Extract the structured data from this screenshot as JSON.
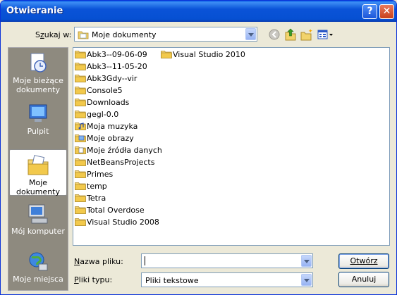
{
  "window": {
    "title": "Otwieranie",
    "help_label": "?",
    "close_label": "✕"
  },
  "toolbar": {
    "look_in_label": "Szukaj w:",
    "look_in_value": "Moje dokumenty",
    "icons": [
      "back-icon",
      "up-folder-icon",
      "new-folder-icon",
      "views-menu-icon"
    ]
  },
  "places": [
    {
      "label": "Moje bieżące dokumenty",
      "icon": "recent-documents-icon"
    },
    {
      "label": "Pulpit",
      "icon": "desktop-icon"
    },
    {
      "label": "Moje dokumenty",
      "icon": "my-documents-icon",
      "selected": true
    },
    {
      "label": "Mój komputer",
      "icon": "my-computer-icon"
    },
    {
      "label": "Moje miejsca",
      "icon": "network-places-icon"
    }
  ],
  "files_col1": [
    {
      "name": "Abk3--09-06-09",
      "icon": "folder"
    },
    {
      "name": "Abk3--11-05-20",
      "icon": "folder"
    },
    {
      "name": "Abk3Gdy--vir",
      "icon": "folder"
    },
    {
      "name": "Console5",
      "icon": "folder"
    },
    {
      "name": "Downloads",
      "icon": "folder"
    },
    {
      "name": "gegl-0.0",
      "icon": "folder"
    },
    {
      "name": "Moja muzyka",
      "icon": "music-folder"
    },
    {
      "name": "Moje obrazy",
      "icon": "pictures-folder"
    },
    {
      "name": "Moje źródła danych",
      "icon": "data-sources-folder"
    },
    {
      "name": "NetBeansProjects",
      "icon": "folder"
    },
    {
      "name": "Primes",
      "icon": "folder"
    },
    {
      "name": "temp",
      "icon": "folder"
    },
    {
      "name": "Tetra",
      "icon": "folder"
    },
    {
      "name": "Total Overdose",
      "icon": "folder"
    },
    {
      "name": "Visual Studio 2008",
      "icon": "folder"
    }
  ],
  "files_col2": [
    {
      "name": "Visual Studio 2010",
      "icon": "folder"
    }
  ],
  "filename": {
    "label": "Nazwa pliku:",
    "value": ""
  },
  "filetype": {
    "label": "Pliki typu:",
    "value": "Pliki tekstowe"
  },
  "buttons": {
    "open": "Otwórz",
    "cancel": "Anuluj"
  }
}
